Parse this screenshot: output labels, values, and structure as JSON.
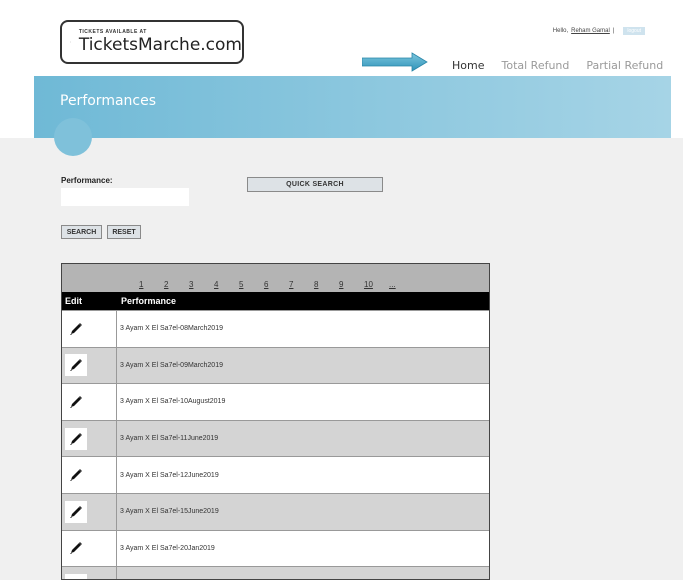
{
  "logo": {
    "small": "TICKETS AVAILABLE AT",
    "big": "TicketsMarche.com"
  },
  "user": {
    "greeting": "Hello,",
    "name": "Reham Gamal",
    "separator": "|",
    "logout": "logout"
  },
  "nav": [
    {
      "label": "Home",
      "active": true
    },
    {
      "label": "Total Refund",
      "active": false
    },
    {
      "label": "Partial Refund",
      "active": false
    }
  ],
  "banner": {
    "title": "Performances"
  },
  "form": {
    "performance_label": "Performance:",
    "performance_value": "",
    "quick_search": "QUICK SEARCH",
    "search": "SEARCH",
    "reset": "RESET"
  },
  "table": {
    "pages": [
      "1",
      "2",
      "3",
      "4",
      "5",
      "6",
      "7",
      "8",
      "9",
      "10",
      "..."
    ],
    "headers": {
      "edit": "Edit",
      "performance": "Performance"
    },
    "rows": [
      "3 Ayam X El Sa7el-08March2019",
      "3 Ayam X El Sa7el-09March2019",
      "3 Ayam X El Sa7el-10August2019",
      "3 Ayam X El Sa7el-11June2019",
      "3 Ayam X El Sa7el-12June2019",
      "3 Ayam X El Sa7el-15June2019",
      "3 Ayam X El Sa7el-20Jan2019",
      ""
    ]
  },
  "colors": {
    "banner_start": "#6fb9d6",
    "banner_end": "#a6d4e6",
    "arrow": "#4aa8c8",
    "header_bg": "#000000"
  }
}
